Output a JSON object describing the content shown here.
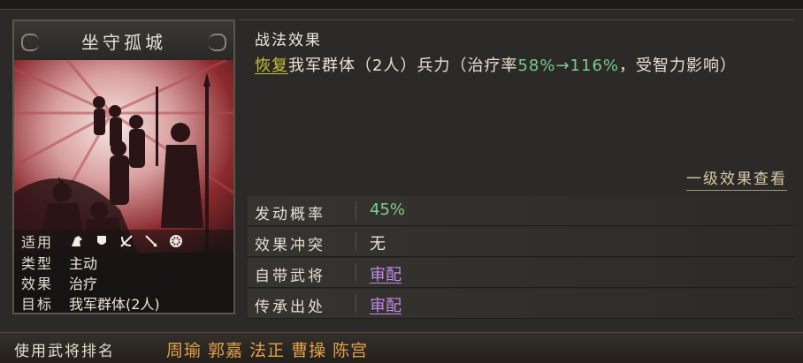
{
  "card": {
    "title": "坐守孤城",
    "stats": [
      {
        "label": "适用",
        "value": ""
      },
      {
        "label": "类型",
        "value": "主动"
      },
      {
        "label": "效果",
        "value": "治疗"
      },
      {
        "label": "目标",
        "value": "我军群体(2人)"
      }
    ],
    "arms_icons": [
      "cavalry-icon",
      "shield-icon",
      "bow-icon",
      "spear-icon",
      "siege-icon"
    ]
  },
  "effect": {
    "title": "战法效果",
    "keyword": "恢复",
    "text_part1": "我军群体（2人）兵力（治疗率",
    "rate_value": "58%→116%",
    "text_part2": "，受智力影响）",
    "level_link": "一级效果查看"
  },
  "attributes": [
    {
      "label": "发动概率",
      "value": "45%",
      "color": "#7ecf8b"
    },
    {
      "label": "效果冲突",
      "value": "无",
      "color": "#ebe4d4"
    },
    {
      "label": "自带武将",
      "value": "审配",
      "color": "#c489e3"
    },
    {
      "label": "传承出处",
      "value": "审配",
      "color": "#c489e3"
    }
  ],
  "users": {
    "label": "使用武将排名",
    "names": "周瑜 郭嘉 法正 曹操 陈宫"
  }
}
